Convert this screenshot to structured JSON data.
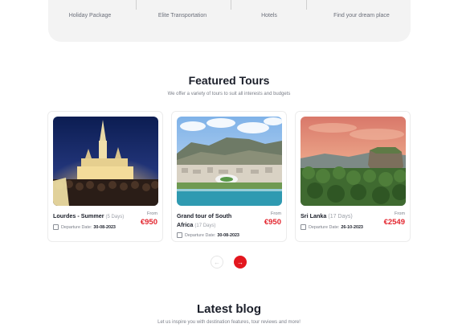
{
  "stats": [
    {
      "label": "Holiday Package"
    },
    {
      "label": "Elite Transportation"
    },
    {
      "label": "Hotels"
    },
    {
      "label": "Find your dream place"
    }
  ],
  "featured": {
    "title": "Featured Tours",
    "subtitle": "We offer a variety of tours to suit all interests and budgets"
  },
  "tours": [
    {
      "title": "Lourdes - Summer",
      "days": "(5 Days)",
      "date_label": "Departure Date:",
      "date": "30-08-2023",
      "from_label": "From",
      "price": "€950",
      "image": "lourdes-basilica-night"
    },
    {
      "title": "Grand tour of South Africa",
      "days": "(17 Days)",
      "date_label": "Departure Date:",
      "date": "30-08-2023",
      "from_label": "From",
      "price": "€950",
      "image": "cape-town-aerial"
    },
    {
      "title": "Sri Lanka",
      "days": "(17 Days)",
      "date_label": "Departure Date:",
      "date": "26-10-2023",
      "from_label": "From",
      "price": "€2549",
      "image": "sigiriya-rock-sunset"
    }
  ],
  "carousel": {
    "prev_icon": "arrow-left-icon",
    "next_icon": "arrow-right-icon",
    "accent": "#e3161e"
  },
  "blog": {
    "title": "Latest blog",
    "subtitle": "Let us inspire you with destination features, tour reviews and more!"
  },
  "colors": {
    "price": "#e3262f",
    "panel": "#f3f3f3"
  }
}
